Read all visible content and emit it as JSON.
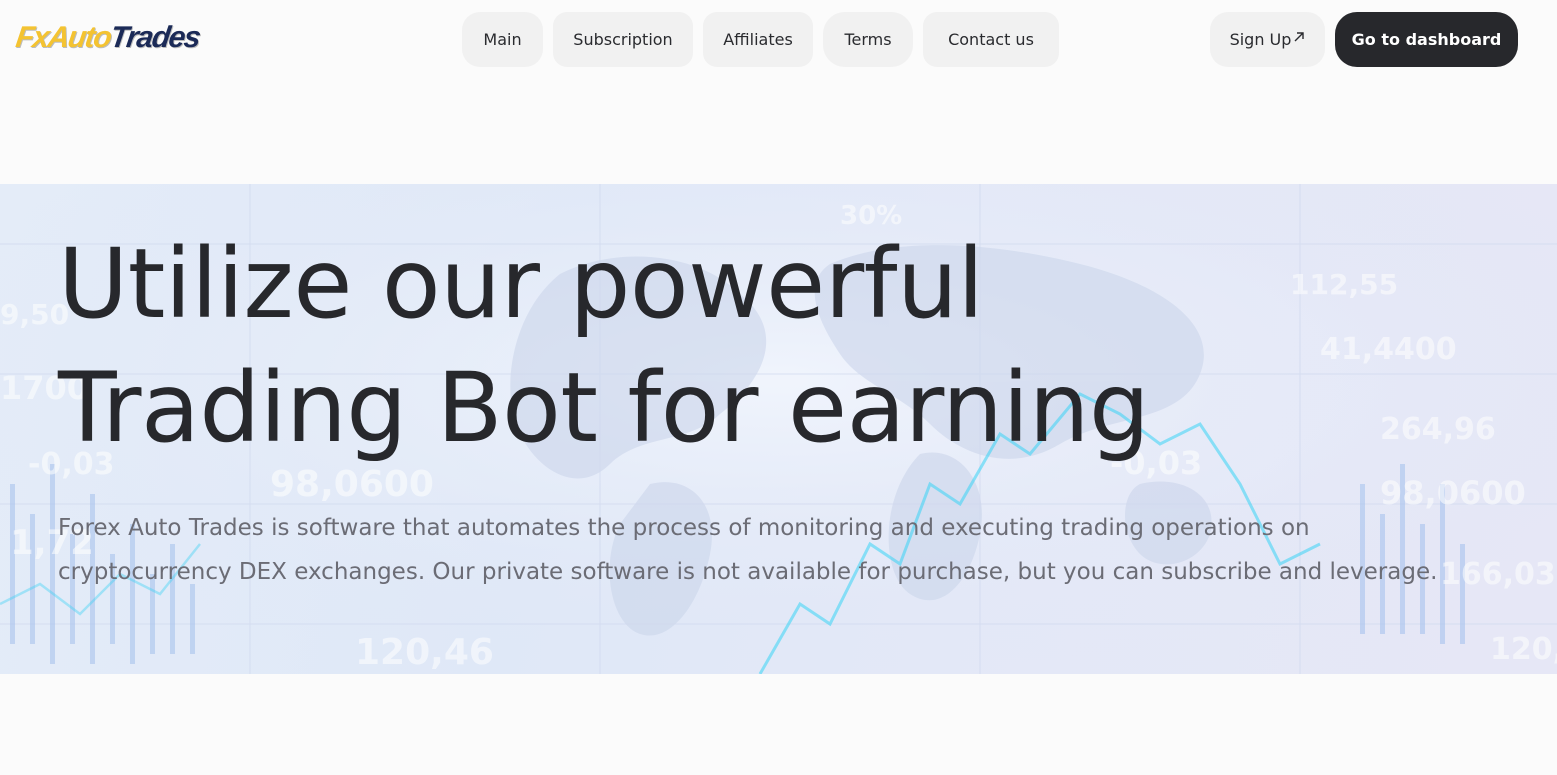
{
  "header": {
    "logo": {
      "part1": "Fx",
      "part2": "Auto",
      "part3": "Trades"
    },
    "nav": [
      {
        "label": "Main"
      },
      {
        "label": "Subscription"
      },
      {
        "label": "Affiliates"
      },
      {
        "label": "Terms"
      },
      {
        "label": "Contact us"
      }
    ],
    "signup_label": "Sign Up",
    "signup_icon": "arrow-up-right-icon",
    "dashboard_label": "Go to dashboard"
  },
  "hero": {
    "title_line1": "Utilize our powerful",
    "title_line2": "Trading Bot for earning",
    "description": "Forex Auto Trades is software that automates the process of monitoring and executing trading operations on cryptocurrency DEX exchanges. Our private software is not available for purchase, but you can subscribe and leverage.",
    "background_numbers": [
      "98,0600",
      "-0,03",
      "1,72",
      "120,46",
      "41,4400",
      "264,96",
      "112,55",
      "98,0600",
      "166,03",
      "120,",
      "1700",
      "9,50",
      "-0,03",
      "30%",
      "98,0600"
    ]
  },
  "colors": {
    "background": "#fbfbfb",
    "text_dark": "#27282c",
    "text_muted": "#6b6c75",
    "pill_bg": "#f1f1f1",
    "dashboard_bg": "#27282c",
    "logo_yellow": "#f4c331",
    "logo_navy": "#1b2a57",
    "chart_cyan": "#39d3f5"
  }
}
